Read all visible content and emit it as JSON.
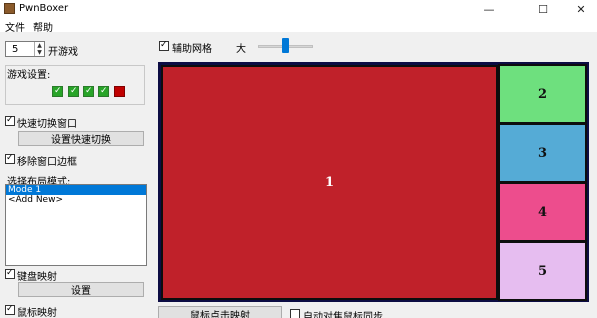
{
  "window": {
    "title": "PwnBoxer",
    "minimize": "—",
    "maximize": "☐",
    "close": "✕"
  },
  "menu": [
    "文件",
    "帮助"
  ],
  "left": {
    "game_count": "5",
    "start_game": "开游戏",
    "game_settings_label": "游戏设置:",
    "game_status": [
      "ok",
      "ok",
      "ok",
      "ok",
      "error"
    ],
    "quick_switch_label": "快速切换窗口",
    "quick_switch_checked": true,
    "set_quick_switch": "设置快速切换",
    "remove_border_label": "移除窗口边框",
    "remove_border_checked": true,
    "layout_mode_label": "选择布局模式:",
    "layout_modes": [
      "Mode 1",
      "<Add New>"
    ],
    "selected_layout": "Mode 1",
    "keyboard_map_label": "键盘映射",
    "keyboard_map_checked": true,
    "settings_button": "设置",
    "mouse_map_label": "鼠标映射",
    "mouse_map_checked": true
  },
  "toolbar": {
    "grid_label": "辅助网格",
    "grid_checked": true,
    "size_label": "大",
    "size_level": 0.5
  },
  "bottom": {
    "mouse_click_map": "鼠标点击映射",
    "auto_align_label": "自动对焦鼠标同步",
    "auto_align_checked": false
  },
  "layout": {
    "tiles": [
      {
        "label": "1",
        "color": "#c0212a"
      },
      {
        "label": "2",
        "color": "#6ee07e"
      },
      {
        "label": "3",
        "color": "#55abd6"
      },
      {
        "label": "4",
        "color": "#ed4d8d"
      },
      {
        "label": "5",
        "color": "#e6bdf0"
      }
    ]
  }
}
